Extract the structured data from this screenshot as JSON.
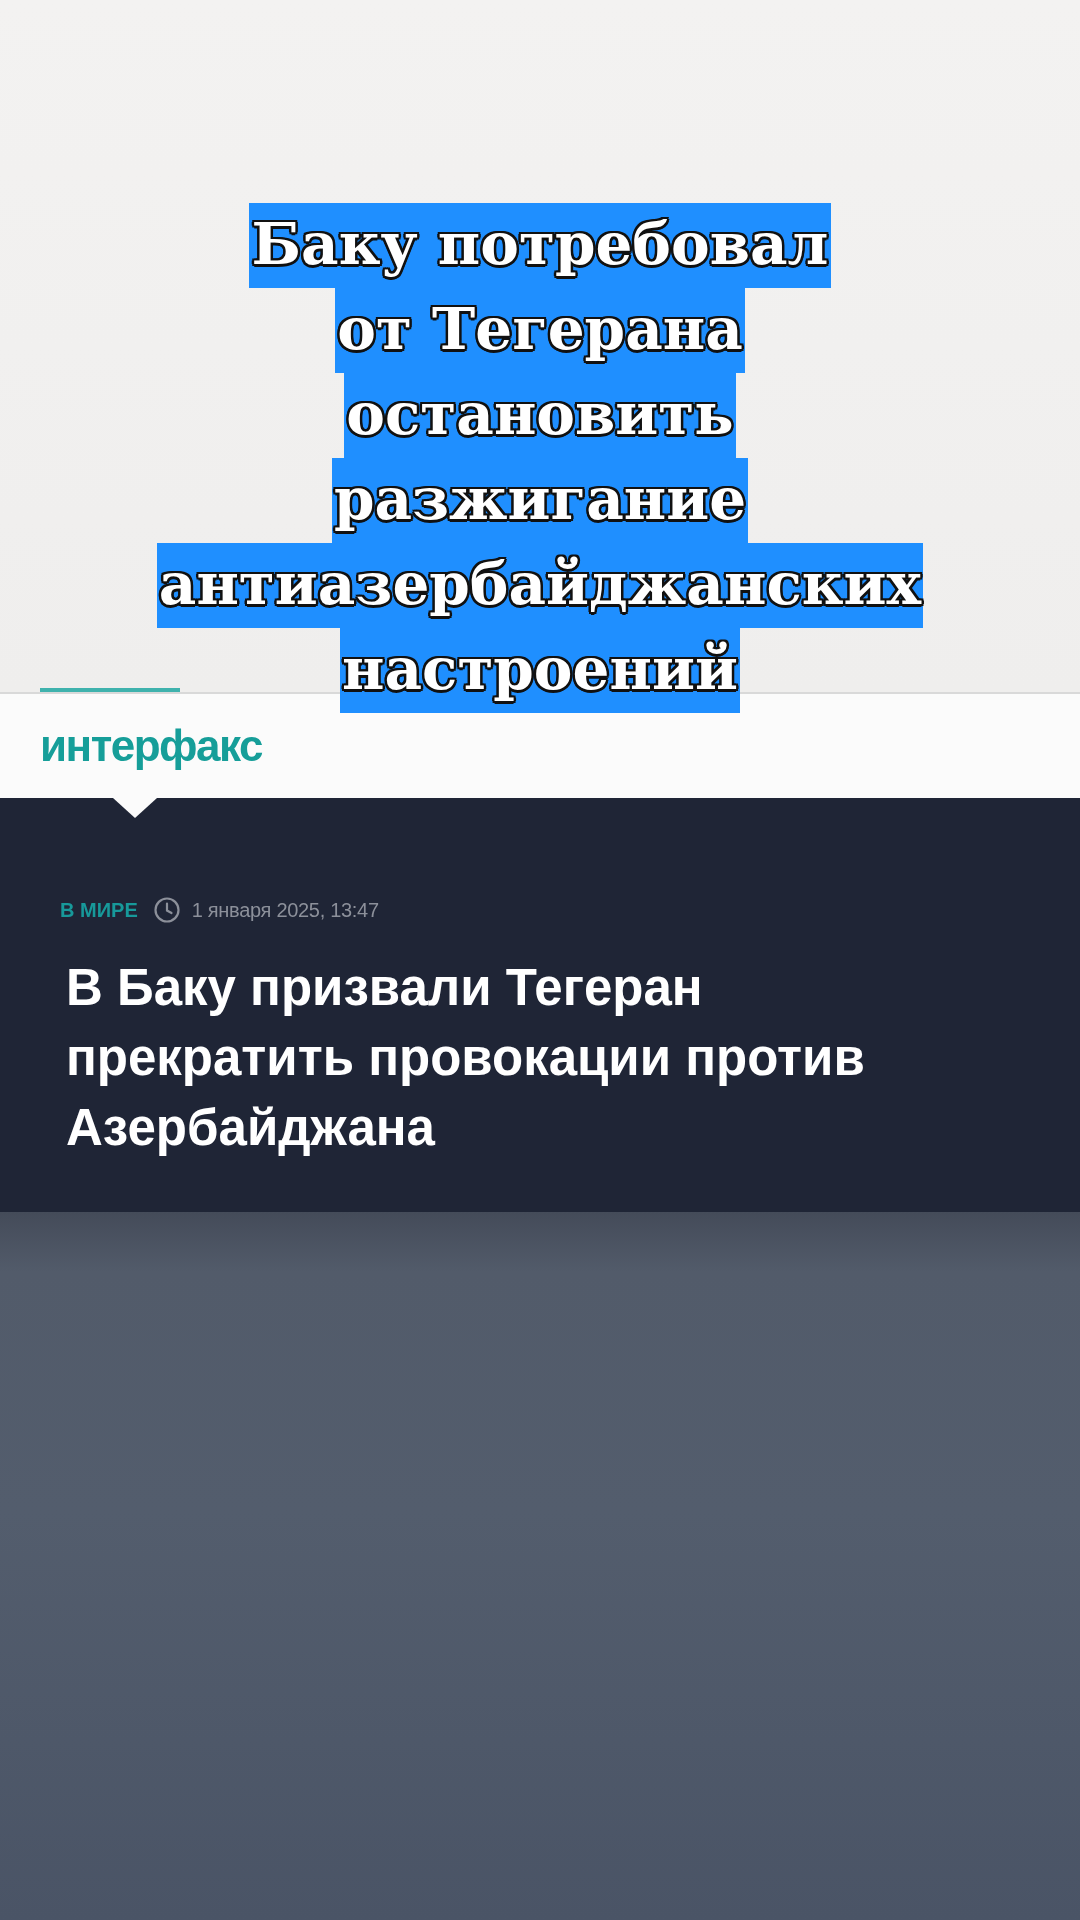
{
  "overlay": {
    "lines": [
      "Баку потребовал",
      "от Тегерана",
      "остановить",
      "разжигание",
      "антиазербайджанских",
      "настроений"
    ]
  },
  "site_header": {
    "logo": "интерфакс"
  },
  "article": {
    "category": "В МИРЕ",
    "date": "1 января 2025, 13:47",
    "headline": "В Баку призвали Тегеран прекратить провокации против Азербайджана"
  }
}
